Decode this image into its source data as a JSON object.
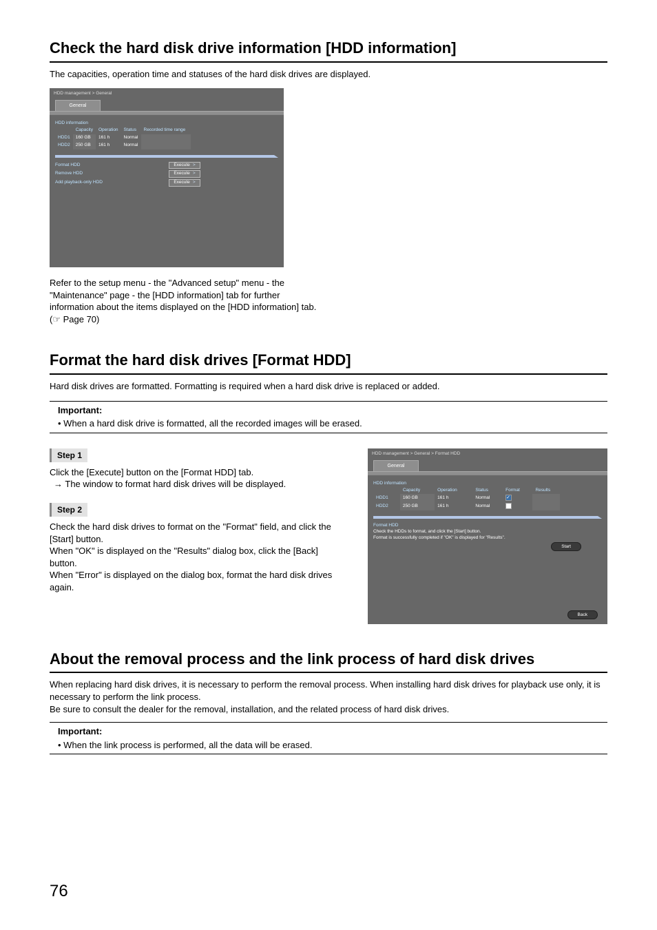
{
  "sec1": {
    "title": "Check the hard disk drive information [HDD information]",
    "intro": "The capacities, operation time and statuses of the hard disk drives are displayed.",
    "ref": "Refer to the setup menu - the \"Advanced setup\" menu - the \"Maintenance\" page - the [HDD information] tab for further information about the items displayed on the [HDD information] tab. (☞ Page 70)"
  },
  "shot1": {
    "breadcrumb": "HDD management > General",
    "tab": "General",
    "panel_title": "HDD information",
    "headers": {
      "capacity": "Capacity",
      "operation": "Operation",
      "status": "Status",
      "range": "Recorded time range"
    },
    "rows": [
      {
        "id": "HDD1",
        "cap": "160 GB",
        "op": "161 h",
        "status": "Normal",
        "range": ""
      },
      {
        "id": "HDD2",
        "cap": "250 GB",
        "op": "161 h",
        "status": "Normal",
        "range": ""
      }
    ],
    "actions": {
      "format": "Format HDD",
      "remove": "Remove HDD",
      "add": "Add playback-only HDD",
      "exec": "Execute"
    }
  },
  "sec2": {
    "title": "Format the hard disk drives [Format HDD]",
    "intro": "Hard disk drives are formatted. Formatting is required when a hard disk drive is replaced or added.",
    "important_title": "Important:",
    "important_item": "When a hard disk drive is formatted, all the recorded images will be erased.",
    "step1_label": "Step 1",
    "step1_a": "Click the [Execute] button on the [Format HDD] tab.",
    "step1_b": "→ The window to format hard disk drives will be displayed.",
    "step2_label": "Step 2",
    "step2_a": "Check the hard disk drives to format on the \"Format\" field, and click the [Start] button.",
    "step2_b": "When \"OK\" is displayed on the \"Results\" dialog box, click the [Back] button.",
    "step2_c": "When \"Error\" is displayed on the dialog box, format the hard disk drives again."
  },
  "shot2": {
    "breadcrumb": "HDD management > General > Format HDD",
    "tab": "General",
    "panel_title": "HDD information",
    "headers": {
      "capacity": "Capacity",
      "operation": "Operation",
      "status": "Status",
      "format": "Format",
      "results": "Results"
    },
    "rows": [
      {
        "id": "HDD1",
        "cap": "160 GB",
        "op": "161 h",
        "status": "Normal",
        "checked": true
      },
      {
        "id": "HDD2",
        "cap": "250 GB",
        "op": "161 h",
        "status": "Normal",
        "checked": false
      }
    ],
    "format_section_title": "Format HDD",
    "hint1": "Check the HDDs to format, and click the [Start] button.",
    "hint2": "Format is successfully completed if \"OK\" is displayed for \"Results\".",
    "start": "Start",
    "back": "Back"
  },
  "sec3": {
    "title": "About the removal process and the link process of hard disk drives",
    "p1": "When replacing hard disk drives, it is necessary to perform the removal process. When installing hard disk drives for playback use only, it is necessary to perform the link process.",
    "p2": "Be sure to consult the dealer for the removal, installation, and the related process of hard disk drives.",
    "important_title": "Important:",
    "important_item": "When the link process is performed, all the data will be erased."
  },
  "page_number": "76"
}
